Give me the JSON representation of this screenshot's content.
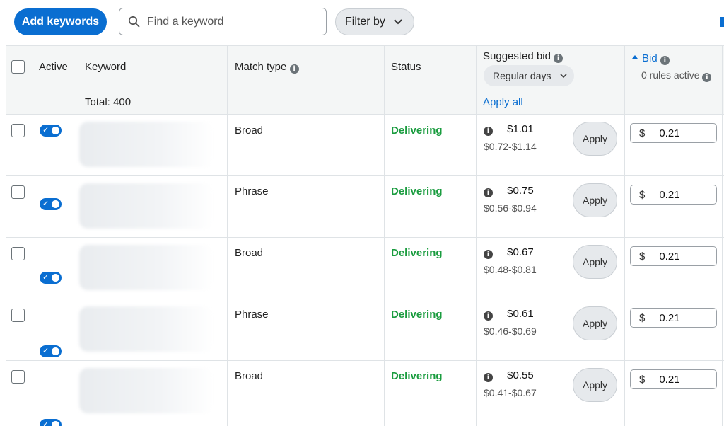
{
  "toolbar": {
    "add_keywords_label": "Add keywords",
    "search_placeholder": "Find a keyword",
    "filter_label": "Filter by"
  },
  "columns": {
    "active": "Active",
    "keyword": "Keyword",
    "match_type": "Match type",
    "status": "Status",
    "suggested_bid": "Suggested bid",
    "suggested_bid_select": "Regular days",
    "bid": "Bid",
    "bid_rules": "0 rules active"
  },
  "totals": {
    "total_label": "Total: 400",
    "apply_all": "Apply all"
  },
  "rows": [
    {
      "match_type": "Broad",
      "status": "Delivering",
      "suggested": "$1.01",
      "range": "$0.72-$1.14",
      "apply": "Apply",
      "currency": "$",
      "bid": "0.21"
    },
    {
      "match_type": "Phrase",
      "status": "Delivering",
      "suggested": "$0.75",
      "range": "$0.56-$0.94",
      "apply": "Apply",
      "currency": "$",
      "bid": "0.21"
    },
    {
      "match_type": "Broad",
      "status": "Delivering",
      "suggested": "$0.67",
      "range": "$0.48-$0.81",
      "apply": "Apply",
      "currency": "$",
      "bid": "0.21"
    },
    {
      "match_type": "Phrase",
      "status": "Delivering",
      "suggested": "$0.61",
      "range": "$0.46-$0.69",
      "apply": "Apply",
      "currency": "$",
      "bid": "0.21"
    },
    {
      "match_type": "Broad",
      "status": "Delivering",
      "suggested": "$0.55",
      "range": "$0.41-$0.67",
      "apply": "Apply",
      "currency": "$",
      "bid": "0.21"
    }
  ],
  "colors": {
    "accent": "#0a6ed1",
    "status_green": "#1a9c3f",
    "header_bg": "#f4f6f6"
  }
}
